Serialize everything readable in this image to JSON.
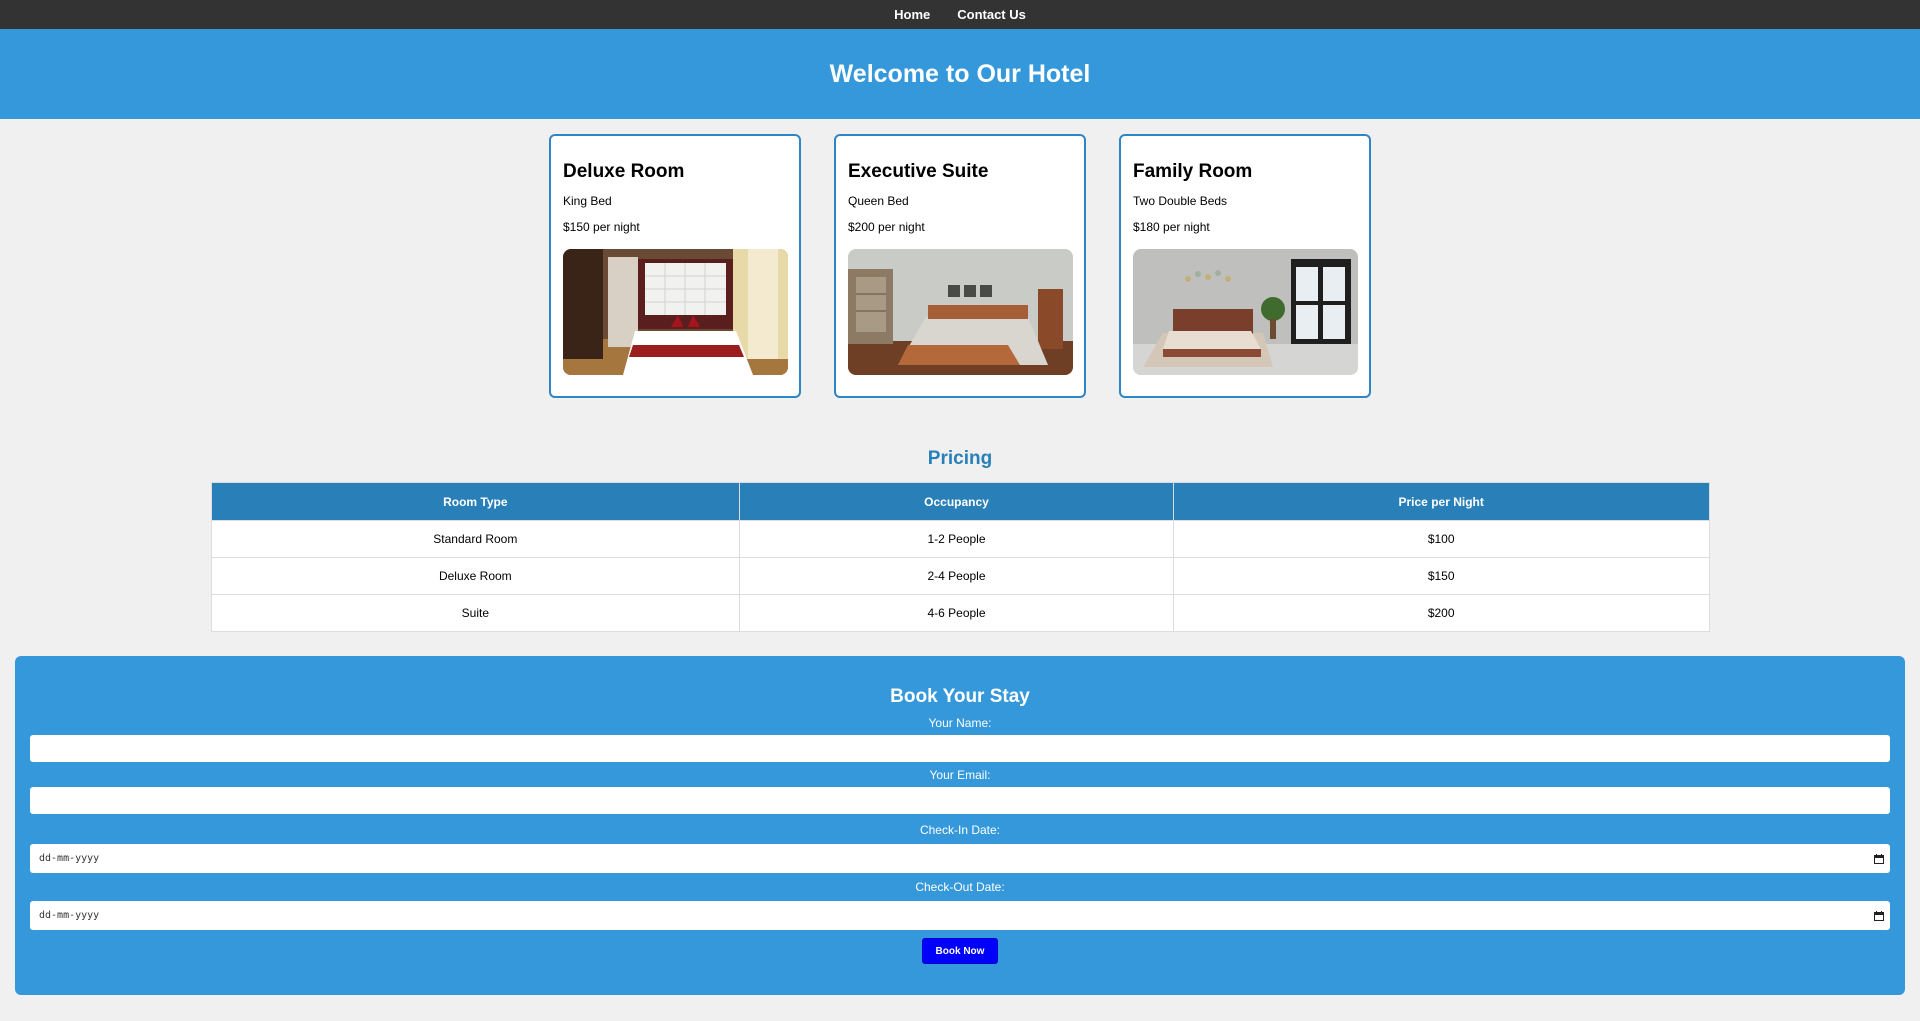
{
  "nav": {
    "home": "Home",
    "contact": "Contact Us"
  },
  "header": {
    "title": "Welcome to Our Hotel"
  },
  "rooms": [
    {
      "name": "Deluxe Room",
      "bed": "King Bed",
      "price": "$150 per night",
      "photo_icon": "hotel-room-photo"
    },
    {
      "name": "Executive Suite",
      "bed": "Queen Bed",
      "price": "$200 per night",
      "photo_icon": "hotel-room-photo"
    },
    {
      "name": "Family Room",
      "bed": "Two Double Beds",
      "price": "$180 per night",
      "photo_icon": "hotel-room-photo"
    }
  ],
  "pricing": {
    "title": "Pricing",
    "headers": [
      "Room Type",
      "Occupancy",
      "Price per Night"
    ],
    "rows": [
      [
        "Standard Room",
        "1-2 People",
        "$100"
      ],
      [
        "Deluxe Room",
        "2-4 People",
        "$150"
      ],
      [
        "Suite",
        "4-6 People",
        "$200"
      ]
    ]
  },
  "booking": {
    "title": "Book Your Stay",
    "name_label": "Your Name:",
    "name_value": "",
    "email_label": "Your Email:",
    "email_value": "",
    "checkin_label": "Check-In Date:",
    "checkin_placeholder": "dd-mm-yyyy",
    "checkout_label": "Check-Out Date:",
    "checkout_placeholder": "dd-mm-yyyy",
    "submit_label": "Book Now"
  },
  "colors": {
    "nav_bg": "#333333",
    "header_bg": "#3498db",
    "table_header_bg": "#2980b9",
    "button_bg": "#0000ff"
  }
}
